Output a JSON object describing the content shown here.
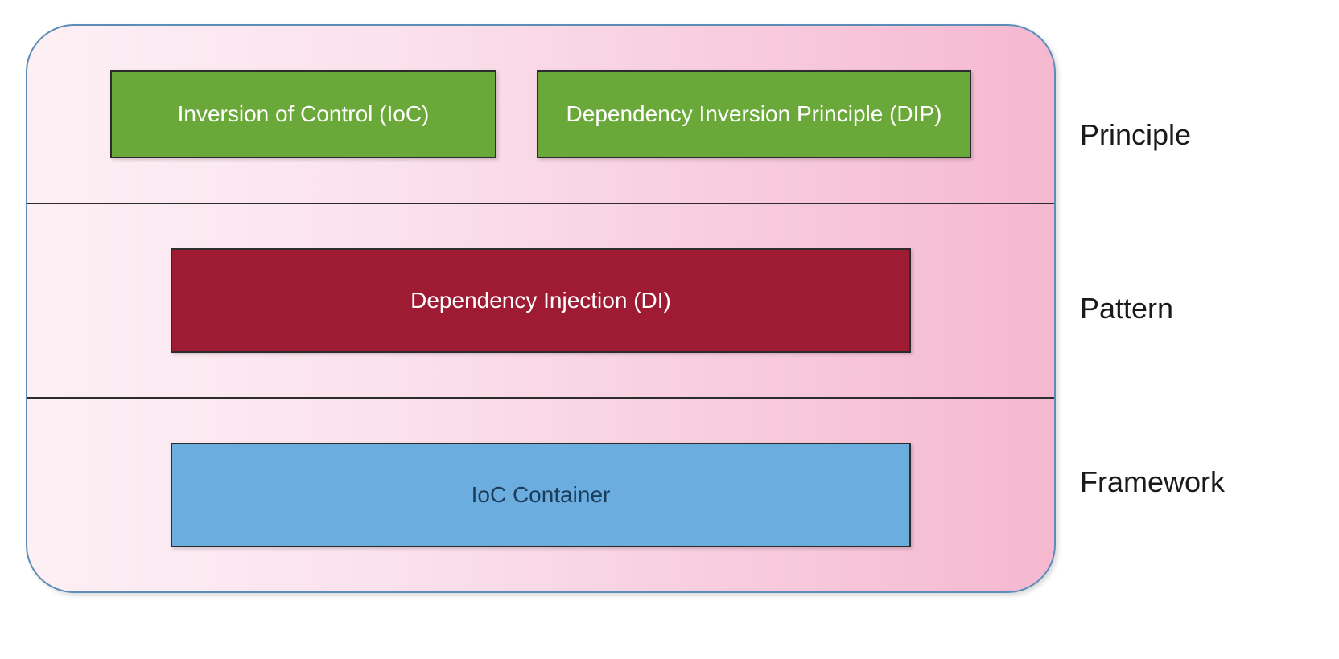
{
  "rows": [
    {
      "label": "Principle",
      "blocks": [
        {
          "text": "Inversion of Control (IoC)",
          "style": "green"
        },
        {
          "text": "Dependency Inversion Principle (DIP)",
          "style": "green green-wide"
        }
      ]
    },
    {
      "label": "Pattern",
      "blocks": [
        {
          "text": "Dependency Injection (DI)",
          "style": "maroon"
        }
      ]
    },
    {
      "label": "Framework",
      "blocks": [
        {
          "text": "IoC Container",
          "style": "blue"
        }
      ]
    }
  ]
}
